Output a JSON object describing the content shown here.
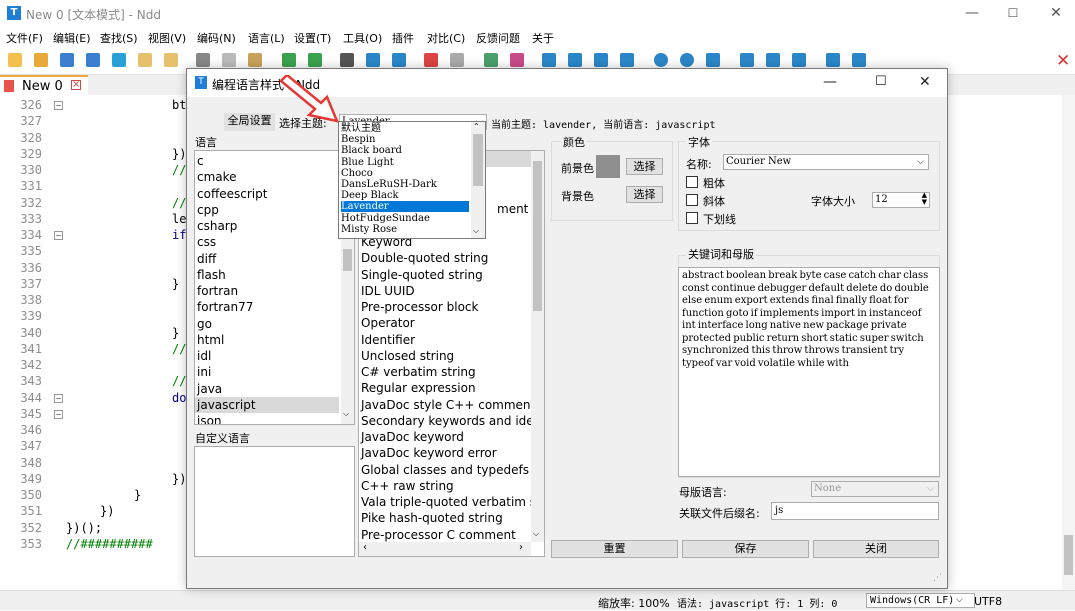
{
  "window": {
    "title": "New 0 [文本模式] - Ndd",
    "app_icon": "T"
  },
  "menu": [
    "文件(F)",
    "编辑(E)",
    "查找(S)",
    "视图(V)",
    "编码(N)",
    "语言(L)",
    "设置(T)",
    "工具(O)",
    "插件",
    "对比(C)",
    "反馈问题",
    "关于"
  ],
  "tab": {
    "label": "New 0",
    "close": "⊠"
  },
  "editor": {
    "lines": [
      {
        "num": "326",
        "code": "bt",
        "fold": true
      },
      {
        "num": "327",
        "code": ""
      },
      {
        "num": "328",
        "code": ""
      },
      {
        "num": "329",
        "code": "})"
      },
      {
        "num": "330",
        "code": "//"
      },
      {
        "num": "331",
        "code": ""
      },
      {
        "num": "332",
        "code": "//"
      },
      {
        "num": "333",
        "code": "le"
      },
      {
        "num": "334",
        "code": "if",
        "fold": true
      },
      {
        "num": "335",
        "code": ""
      },
      {
        "num": "336",
        "code": ""
      },
      {
        "num": "337",
        "code": "}"
      },
      {
        "num": "338",
        "code": ""
      },
      {
        "num": "339",
        "code": ""
      },
      {
        "num": "340",
        "code": "}"
      },
      {
        "num": "341",
        "code": "//"
      },
      {
        "num": "342",
        "code": ""
      },
      {
        "num": "343",
        "code": "//"
      },
      {
        "num": "344",
        "code": "do",
        "fold": true
      },
      {
        "num": "345",
        "code": "",
        "fold": true
      },
      {
        "num": "346",
        "code": ""
      },
      {
        "num": "347",
        "code": ""
      },
      {
        "num": "348",
        "code": ""
      },
      {
        "num": "349",
        "code": "})"
      },
      {
        "num": "350",
        "code": "}"
      },
      {
        "num": "351",
        "code": "})"
      },
      {
        "num": "352",
        "code": "})();"
      },
      {
        "num": "353",
        "code": "//##########"
      }
    ]
  },
  "status": {
    "zoom": "缩放率: 100%",
    "lang": "语法: javascript 行: 1 列: 0",
    "eol": "Windows(CR LF)",
    "enc": "UTF8"
  },
  "dialog": {
    "title": "编程语言样式 - Ndd",
    "global_btn": "全局设置",
    "select_theme_label": "选择主题:",
    "theme_value": "Lavender",
    "current": "当前主题: lavender, 当前语言: javascript",
    "lang_label": "语言",
    "languages": [
      "c",
      "cmake",
      "coffeescript",
      "cpp",
      "csharp",
      "css",
      "diff",
      "flash",
      "fortran",
      "fortran77",
      "go",
      "html",
      "idl",
      "ini",
      "java",
      "javascript",
      "json"
    ],
    "selected_language": "javascript",
    "custom_lang_label": "自定义语言",
    "styles_partial": [
      "ment"
    ],
    "styles": [
      "Keyword",
      "Double-quoted string",
      "Single-quoted string",
      "IDL UUID",
      "Pre-processor block",
      "Operator",
      "Identifier",
      "Unclosed string",
      "C# verbatim string",
      "Regular expression",
      "JavaDoc style C++ comment",
      "Secondary keywords and ident",
      "JavaDoc keyword",
      "JavaDoc keyword error",
      "Global classes and typedefs",
      "C++ raw string",
      "Vala triple-quoted verbatim str",
      "Pike hash-quoted string",
      "Pre-processor C comment"
    ],
    "theme_options": [
      "默认主题",
      "Bespin",
      "Black board",
      "Blue Light",
      "Choco",
      "DansLeRuSH-Dark",
      "Deep Black",
      "Lavender",
      "HotFudgeSundae",
      "Misty Rose"
    ],
    "color_group": "颜色",
    "fg_label": "前景色",
    "bg_label": "背景色",
    "choose": "选择",
    "fg_color": "#8f8f8f",
    "font_group": "字体",
    "font_name_label": "名称:",
    "font_name": "Courier New",
    "bold": "粗体",
    "italic": "斜体",
    "underline": "下划线",
    "font_size_label": "字体大小",
    "font_size": "12",
    "keywords_group": "关键词和母版",
    "keywords": "abstract boolean break byte case catch char class const continue debugger default delete do double else enum export extends final finally float for function goto if implements import in instanceof int interface long native new package private protected public return short static super switch synchronized this throw throws transient try typeof var void volatile while with",
    "parent_lang_label": "母版语言:",
    "parent_lang": "None",
    "ext_label": "关联文件后缀名:",
    "ext": "js",
    "reset": "重置",
    "save": "保存",
    "close": "关闭"
  }
}
